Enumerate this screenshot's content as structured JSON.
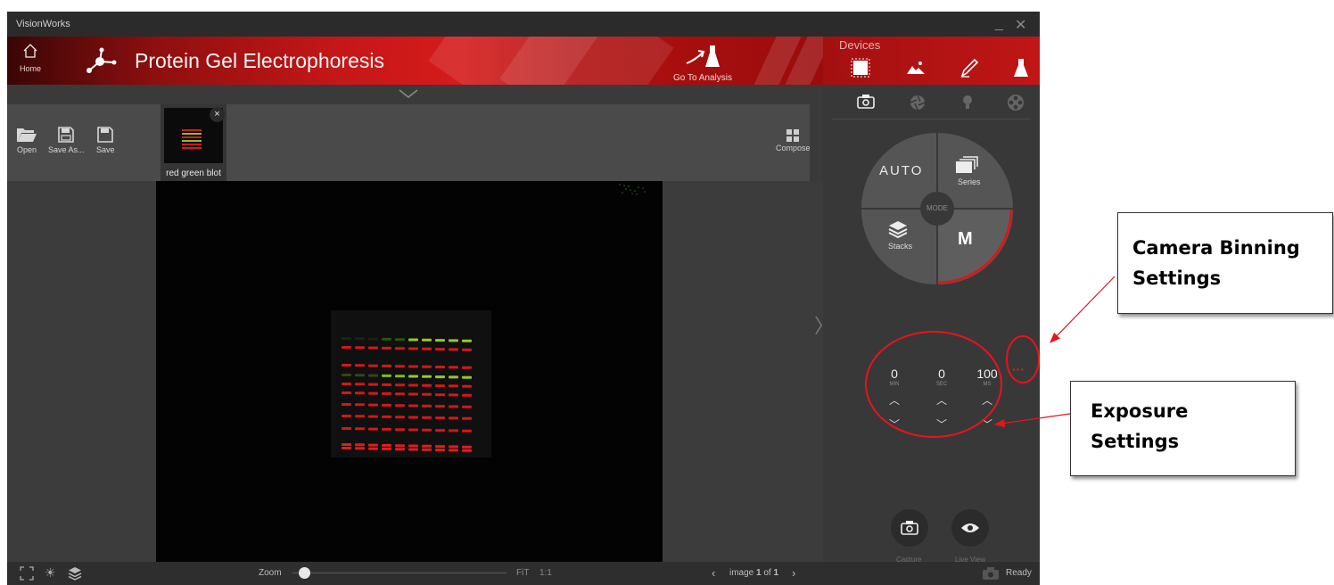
{
  "window": {
    "title": "VisionWorks",
    "minimize_icon": "minimize-icon",
    "close_icon": "close-icon"
  },
  "header": {
    "home_label": "Home",
    "app_title": "Protein Gel Electrophoresis",
    "analysis_label": "Go To Analysis",
    "accent_color": "#c8161b"
  },
  "toolbar": {
    "open_label": "Open",
    "save_as_label": "Save As...",
    "save_label": "Save",
    "compose_label": "Compose",
    "thumbnail_name": "red green blot",
    "thumbnail_close": "×"
  },
  "sidebar": {
    "devices_title": "Devices",
    "device_icons": [
      "imager-icon",
      "image-icon",
      "pen-icon",
      "flask-icon"
    ],
    "sub_icons": [
      "camera-icon",
      "aperture-icon",
      "light-icon",
      "filter-wheel-icon"
    ],
    "modes": {
      "auto": "AUTO",
      "series": "Series",
      "stacks": "Stacks",
      "manual": "M",
      "center": "MODE"
    },
    "exposure": [
      {
        "value": "0",
        "unit": "MIN"
      },
      {
        "value": "0",
        "unit": "SEC"
      },
      {
        "value": "100",
        "unit": "MS"
      }
    ],
    "binning_more": "···",
    "capture_label": "Capture",
    "live_view_label": "Live View"
  },
  "statusbar": {
    "zoom_label": "Zoom",
    "zoom_value": 0.03,
    "fit_label": "FiT",
    "one_to_one_label": "1:1",
    "image_prefix": "image",
    "image_index": "1",
    "image_of": "of",
    "image_total": "1",
    "status_text": "Ready"
  },
  "annotations": {
    "binning": "Camera Binning Settings",
    "exposure": "Exposure Settings",
    "color": "#e8141b"
  }
}
